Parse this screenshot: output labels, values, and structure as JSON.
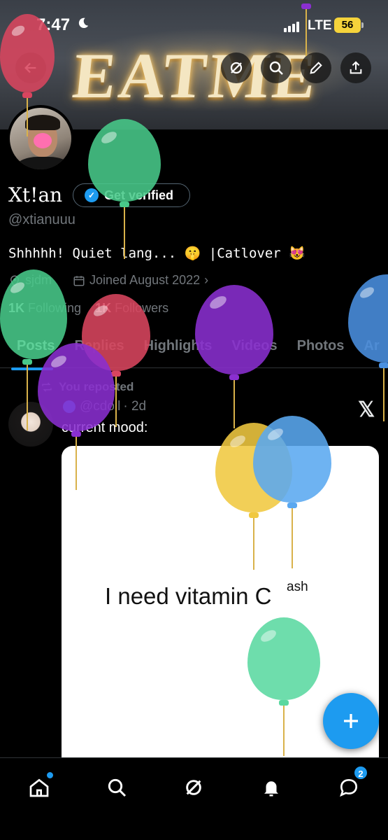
{
  "status_bar": {
    "time": "7:47",
    "network": "LTE",
    "battery": "56"
  },
  "banner": {
    "sign_text": "EATME"
  },
  "header_actions": [
    "back-icon",
    "grok-icon",
    "search-icon",
    "edit-icon",
    "share-icon"
  ],
  "profile": {
    "display_name": "Xt!an",
    "verify_label": "Get verified",
    "handle": "@xtianuuu",
    "bio": "Shhhhh! Quiet lang... 🤫 |Catlover 😻",
    "location": "sjdm",
    "joined": "Joined August 2022",
    "following_count": "1K",
    "following_label": "Following",
    "followers_count": "1K",
    "followers_label": "Followers"
  },
  "tabs": [
    "Posts",
    "Replies",
    "Highlights",
    "Videos",
    "Photos",
    "Ar"
  ],
  "post": {
    "repost_label": "You reposted",
    "author_handle": "@cdoll",
    "time": "· 2d",
    "text": "current mood:",
    "card_text": "I need vitamin C",
    "card_sup": "ash"
  },
  "fab": {
    "icon": "plus-icon"
  },
  "bottom_nav": {
    "items": [
      "home-icon",
      "search-icon",
      "grok-icon",
      "notifications-icon",
      "messages-icon"
    ],
    "messages_badge": "2"
  },
  "colors": {
    "accent": "#1d9bf0",
    "muted": "#71767b",
    "background": "#000000"
  },
  "balloons": [
    {
      "color": "#d9455f"
    },
    {
      "color": "#48c98a"
    },
    {
      "color": "#48c98a"
    },
    {
      "color": "#d9455f"
    },
    {
      "color": "#8a2fd0"
    },
    {
      "color": "#8a2fd0"
    },
    {
      "color": "#4a90e0"
    },
    {
      "color": "#f0c840"
    },
    {
      "color": "#5aa8f0"
    },
    {
      "color": "#5ad8a0"
    }
  ]
}
